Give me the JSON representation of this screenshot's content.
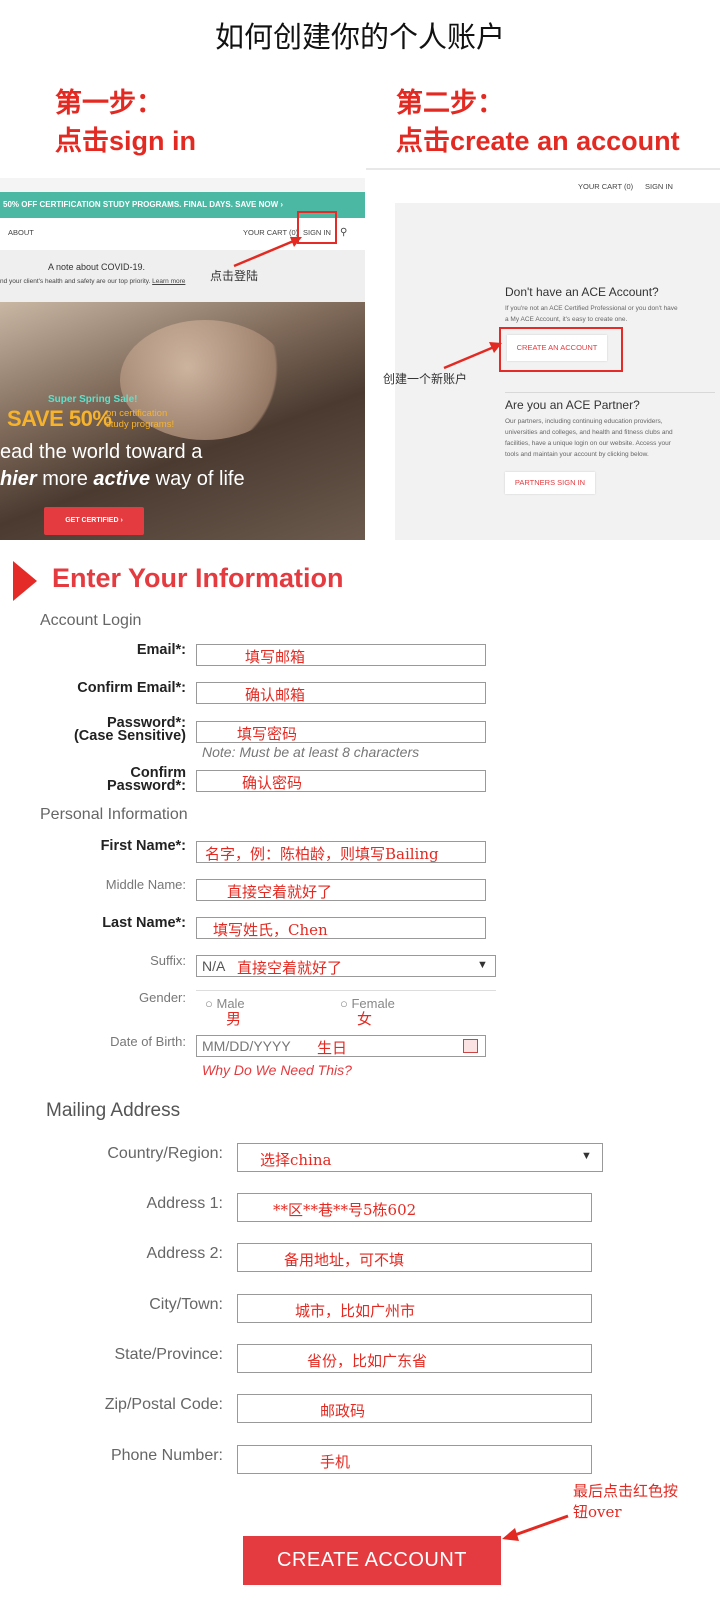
{
  "page_title": "如何创建你的个人账户",
  "step1": {
    "title": "第一步：",
    "prefix": "点击",
    "action": "sign in"
  },
  "step2": {
    "title": "第二步：",
    "prefix": "点击",
    "action": "create an account"
  },
  "screenshot1": {
    "promo": "50% OFF CERTIFICATION STUDY PROGRAMS. FINAL DAYS. SAVE NOW ›",
    "nav_about": "ABOUT",
    "nav_cart": "YOUR CART (0)",
    "nav_signin": "SIGN IN",
    "covid_note": "A note about COVID-19.",
    "covid_text": "nd your client's health and safety are our top priority.",
    "covid_link": "Learn more",
    "sale_title": "Super Spring Sale!",
    "save": "SAVE 50%",
    "save_detail1": "on certification",
    "save_detail2": "study programs!",
    "hero_line1": "ead the world toward a",
    "hero_line2a": "hier",
    "hero_line2b": "more",
    "hero_line2c": "active",
    "hero_line2d": "way of life",
    "cta": "GET CERTIFIED ›",
    "annotation": "点击登陆"
  },
  "screenshot2": {
    "nav_cart": "YOUR CART (0)",
    "nav_signin": "SIGN IN",
    "q1": "Don't have an ACE Account?",
    "q1_text1": "If you're not an ACE Certified Professional or you don't have",
    "q1_text2": "a My ACE Account, it's easy to create one.",
    "create_btn": "CREATE AN ACCOUNT",
    "q2": "Are you an ACE Partner?",
    "q2_text1": "Our partners, including continuing education providers,",
    "q2_text2": "universities and colleges, and health and fitness clubs and",
    "q2_text3": "facilities, have a unique login on our website. Access your",
    "q2_text4": "tools and maintain your account by clicking below.",
    "partner_btn": "PARTNERS SIGN IN",
    "annotation": "创建一个新账户"
  },
  "form": {
    "heading": "Enter Your Information",
    "account_login": "Account Login",
    "email_label": "Email*:",
    "email_fill": "填写邮箱",
    "confirm_email_label": "Confirm Email*:",
    "confirm_email_fill": "确认邮箱",
    "password_label": "Password*:",
    "password_case": "(Case Sensitive)",
    "password_fill": "填写密码",
    "password_note": "Note: Must be at least 8 characters",
    "confirm_password_label1": "Confirm",
    "confirm_password_label2": "Password*:",
    "confirm_password_fill": "确认密码",
    "personal_info": "Personal Information",
    "first_name_label": "First Name*:",
    "first_name_fill": "名字，例：陈柏龄，则填写Bailing",
    "middle_name_label": "Middle Name:",
    "middle_name_fill": "直接空着就好了",
    "last_name_label": "Last Name*:",
    "last_name_fill": "填写姓氏，Chen",
    "suffix_label": "Suffix:",
    "suffix_value": "N/A",
    "suffix_fill": "直接空着就好了",
    "gender_label": "Gender:",
    "male": "Male",
    "male_fill": "男",
    "female": "Female",
    "female_fill": "女",
    "dob_label": "Date of Birth:",
    "dob_placeholder": "MM/DD/YYYY",
    "dob_fill": "生日",
    "why": "Why Do We Need This?"
  },
  "mailing": {
    "heading": "Mailing Address",
    "country_label": "Country/Region:",
    "country_fill": "选择china",
    "address1_label": "Address 1:",
    "address1_fill": "**区**巷**号5栋602",
    "address2_label": "Address 2:",
    "address2_fill": "备用地址，可不填",
    "city_label": "City/Town:",
    "city_fill": "城市，比如广州市",
    "state_label": "State/Province:",
    "state_fill": "省份，比如广东省",
    "zip_label": "Zip/Postal Code:",
    "zip_fill": "邮政码",
    "phone_label": "Phone Number:",
    "phone_fill": "手机",
    "final_note1": "最后点击红色按",
    "final_note2": "钮over",
    "submit": "CREATE ACCOUNT"
  },
  "colors": {
    "accent": "#e32a22",
    "button": "#e33b3f",
    "promo": "#4ab8a3"
  }
}
